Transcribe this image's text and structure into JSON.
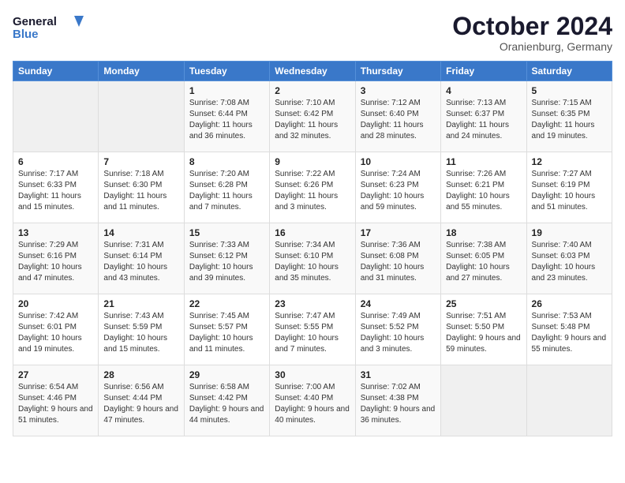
{
  "logo": {
    "line1": "General",
    "line2": "Blue"
  },
  "title": "October 2024",
  "location": "Oranienburg, Germany",
  "days_of_week": [
    "Sunday",
    "Monday",
    "Tuesday",
    "Wednesday",
    "Thursday",
    "Friday",
    "Saturday"
  ],
  "weeks": [
    [
      {
        "day": "",
        "info": ""
      },
      {
        "day": "",
        "info": ""
      },
      {
        "day": "1",
        "info": "Sunrise: 7:08 AM\nSunset: 6:44 PM\nDaylight: 11 hours and 36 minutes."
      },
      {
        "day": "2",
        "info": "Sunrise: 7:10 AM\nSunset: 6:42 PM\nDaylight: 11 hours and 32 minutes."
      },
      {
        "day": "3",
        "info": "Sunrise: 7:12 AM\nSunset: 6:40 PM\nDaylight: 11 hours and 28 minutes."
      },
      {
        "day": "4",
        "info": "Sunrise: 7:13 AM\nSunset: 6:37 PM\nDaylight: 11 hours and 24 minutes."
      },
      {
        "day": "5",
        "info": "Sunrise: 7:15 AM\nSunset: 6:35 PM\nDaylight: 11 hours and 19 minutes."
      }
    ],
    [
      {
        "day": "6",
        "info": "Sunrise: 7:17 AM\nSunset: 6:33 PM\nDaylight: 11 hours and 15 minutes."
      },
      {
        "day": "7",
        "info": "Sunrise: 7:18 AM\nSunset: 6:30 PM\nDaylight: 11 hours and 11 minutes."
      },
      {
        "day": "8",
        "info": "Sunrise: 7:20 AM\nSunset: 6:28 PM\nDaylight: 11 hours and 7 minutes."
      },
      {
        "day": "9",
        "info": "Sunrise: 7:22 AM\nSunset: 6:26 PM\nDaylight: 11 hours and 3 minutes."
      },
      {
        "day": "10",
        "info": "Sunrise: 7:24 AM\nSunset: 6:23 PM\nDaylight: 10 hours and 59 minutes."
      },
      {
        "day": "11",
        "info": "Sunrise: 7:26 AM\nSunset: 6:21 PM\nDaylight: 10 hours and 55 minutes."
      },
      {
        "day": "12",
        "info": "Sunrise: 7:27 AM\nSunset: 6:19 PM\nDaylight: 10 hours and 51 minutes."
      }
    ],
    [
      {
        "day": "13",
        "info": "Sunrise: 7:29 AM\nSunset: 6:16 PM\nDaylight: 10 hours and 47 minutes."
      },
      {
        "day": "14",
        "info": "Sunrise: 7:31 AM\nSunset: 6:14 PM\nDaylight: 10 hours and 43 minutes."
      },
      {
        "day": "15",
        "info": "Sunrise: 7:33 AM\nSunset: 6:12 PM\nDaylight: 10 hours and 39 minutes."
      },
      {
        "day": "16",
        "info": "Sunrise: 7:34 AM\nSunset: 6:10 PM\nDaylight: 10 hours and 35 minutes."
      },
      {
        "day": "17",
        "info": "Sunrise: 7:36 AM\nSunset: 6:08 PM\nDaylight: 10 hours and 31 minutes."
      },
      {
        "day": "18",
        "info": "Sunrise: 7:38 AM\nSunset: 6:05 PM\nDaylight: 10 hours and 27 minutes."
      },
      {
        "day": "19",
        "info": "Sunrise: 7:40 AM\nSunset: 6:03 PM\nDaylight: 10 hours and 23 minutes."
      }
    ],
    [
      {
        "day": "20",
        "info": "Sunrise: 7:42 AM\nSunset: 6:01 PM\nDaylight: 10 hours and 19 minutes."
      },
      {
        "day": "21",
        "info": "Sunrise: 7:43 AM\nSunset: 5:59 PM\nDaylight: 10 hours and 15 minutes."
      },
      {
        "day": "22",
        "info": "Sunrise: 7:45 AM\nSunset: 5:57 PM\nDaylight: 10 hours and 11 minutes."
      },
      {
        "day": "23",
        "info": "Sunrise: 7:47 AM\nSunset: 5:55 PM\nDaylight: 10 hours and 7 minutes."
      },
      {
        "day": "24",
        "info": "Sunrise: 7:49 AM\nSunset: 5:52 PM\nDaylight: 10 hours and 3 minutes."
      },
      {
        "day": "25",
        "info": "Sunrise: 7:51 AM\nSunset: 5:50 PM\nDaylight: 9 hours and 59 minutes."
      },
      {
        "day": "26",
        "info": "Sunrise: 7:53 AM\nSunset: 5:48 PM\nDaylight: 9 hours and 55 minutes."
      }
    ],
    [
      {
        "day": "27",
        "info": "Sunrise: 6:54 AM\nSunset: 4:46 PM\nDaylight: 9 hours and 51 minutes."
      },
      {
        "day": "28",
        "info": "Sunrise: 6:56 AM\nSunset: 4:44 PM\nDaylight: 9 hours and 47 minutes."
      },
      {
        "day": "29",
        "info": "Sunrise: 6:58 AM\nSunset: 4:42 PM\nDaylight: 9 hours and 44 minutes."
      },
      {
        "day": "30",
        "info": "Sunrise: 7:00 AM\nSunset: 4:40 PM\nDaylight: 9 hours and 40 minutes."
      },
      {
        "day": "31",
        "info": "Sunrise: 7:02 AM\nSunset: 4:38 PM\nDaylight: 9 hours and 36 minutes."
      },
      {
        "day": "",
        "info": ""
      },
      {
        "day": "",
        "info": ""
      }
    ]
  ]
}
